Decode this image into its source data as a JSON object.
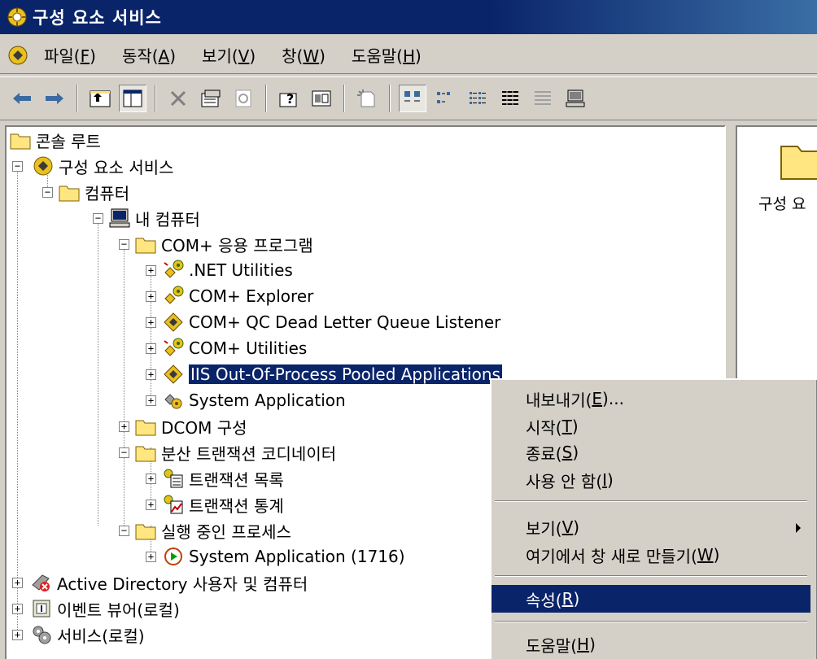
{
  "window": {
    "title": "구성 요소 서비스"
  },
  "menubar": {
    "items": [
      {
        "text": "파일(",
        "key": "F",
        "end": ")"
      },
      {
        "text": "동작(",
        "key": "A",
        "end": ")"
      },
      {
        "text": "보기(",
        "key": "V",
        "end": ")"
      },
      {
        "text": "창(",
        "key": "W",
        "end": ")"
      },
      {
        "text": "도움말(",
        "key": "H",
        "end": ")"
      }
    ]
  },
  "toolbar": {
    "icons": [
      "back-icon",
      "forward-icon",
      "up-folder-icon",
      "show-tree-icon",
      "delete-icon",
      "properties-icon",
      "refresh-icon",
      "help-icon",
      "export-list-icon",
      "new-component-icon",
      "large-icons-icon",
      "small-icons-icon",
      "list-view-icon",
      "detail-view-icon",
      "status-view-icon",
      "computer-icon"
    ]
  },
  "tree": {
    "nodes": [
      {
        "label": "콘솔 루트"
      },
      {
        "label": "구성 요소 서비스"
      },
      {
        "label": "컴퓨터"
      },
      {
        "label": "내 컴퓨터"
      },
      {
        "label": "COM+ 응용 프로그램"
      },
      {
        "label": ".NET Utilities"
      },
      {
        "label": "COM+ Explorer"
      },
      {
        "label": "COM+ QC Dead Letter Queue Listener"
      },
      {
        "label": "COM+ Utilities"
      },
      {
        "label": "IIS Out-Of-Process Pooled Applications"
      },
      {
        "label": "System Application"
      },
      {
        "label": "DCOM 구성"
      },
      {
        "label": "분산 트랜잭션 코디네이터"
      },
      {
        "label": "트랜잭션 목록"
      },
      {
        "label": "트랜잭션 통계"
      },
      {
        "label": "실행 중인 프로세스"
      },
      {
        "label": "System Application (1716)"
      },
      {
        "label": "Active Directory 사용자 및 컴퓨터"
      },
      {
        "label": "이벤트 뷰어(로컬)"
      },
      {
        "label": "서비스(로컬)"
      }
    ]
  },
  "right_pane": {
    "label": "구성 요"
  },
  "context_menu": {
    "items": [
      {
        "text": "내보내기(",
        "key": "E",
        "end": ")..."
      },
      {
        "text": "시작(",
        "key": "T",
        "end": ")"
      },
      {
        "text": "종료(",
        "key": "S",
        "end": ")"
      },
      {
        "text": "사용 안 함(",
        "key": "I",
        "end": ")"
      },
      {
        "text": "보기(",
        "key": "V",
        "end": ")"
      },
      {
        "text": "여기에서 창 새로 만들기(",
        "key": "W",
        "end": ")"
      },
      {
        "text": "속성(",
        "key": "R",
        "end": ")"
      },
      {
        "text": "도움말(",
        "key": "H",
        "end": ")"
      }
    ]
  },
  "colors": {
    "selection": "#0a246a",
    "face": "#d4d0c8",
    "titlebar": "#0a246a"
  }
}
